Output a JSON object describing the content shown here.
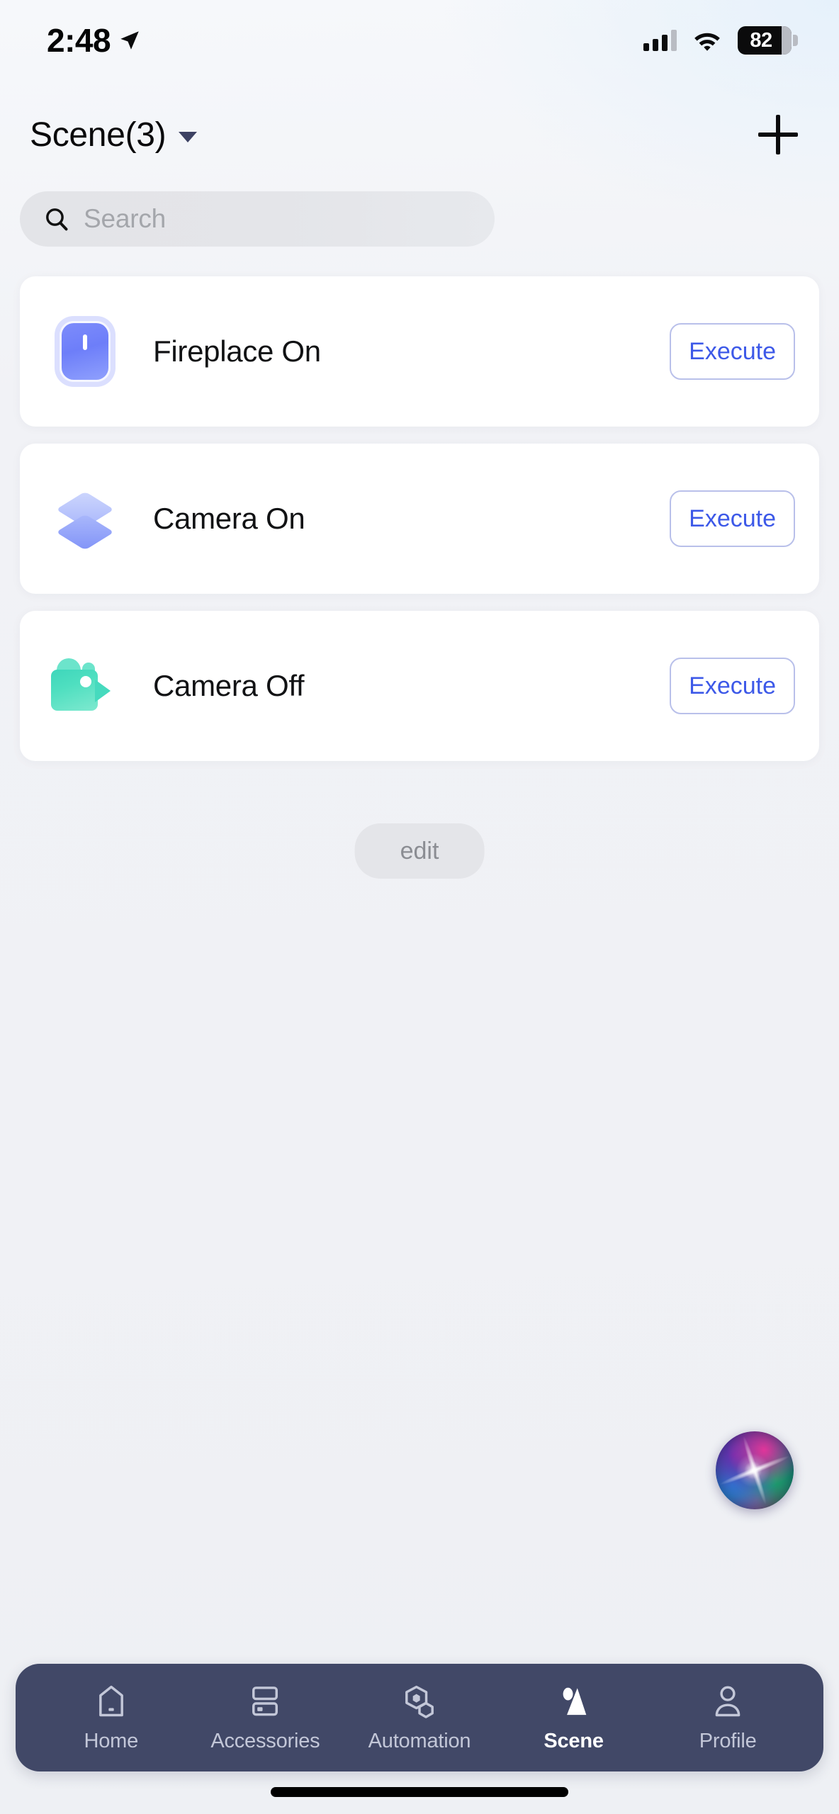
{
  "status_bar": {
    "time": "2:48",
    "location_icon": "location-arrow-icon",
    "signal_icon": "cellular-signal-icon",
    "wifi_icon": "wifi-icon",
    "battery_percent": "82"
  },
  "header": {
    "title": "Scene(3)",
    "dropdown_icon": "chevron-down-icon",
    "add_label": "+",
    "add_icon": "plus-icon"
  },
  "search": {
    "placeholder": "Search",
    "icon": "search-icon",
    "value": ""
  },
  "scenes": [
    {
      "name": "Fireplace On",
      "icon": "switch-icon",
      "icon_color": "#7d8cfb",
      "action_label": "Execute"
    },
    {
      "name": "Camera On",
      "icon": "layers-icon",
      "icon_color": "#8294f8",
      "action_label": "Execute"
    },
    {
      "name": "Camera Off",
      "icon": "video-camera-icon",
      "icon_color": "#46dabe",
      "action_label": "Execute"
    }
  ],
  "edit_button": {
    "label": "edit"
  },
  "assistant": {
    "icon": "siri-orb-icon"
  },
  "tabbar": {
    "items": [
      {
        "label": "Home",
        "icon": "home-icon",
        "active": false
      },
      {
        "label": "Accessories",
        "icon": "devices-icon",
        "active": false
      },
      {
        "label": "Automation",
        "icon": "automation-icon",
        "active": false
      },
      {
        "label": "Scene",
        "icon": "scene-icon",
        "active": true
      },
      {
        "label": "Profile",
        "icon": "person-icon",
        "active": false
      }
    ]
  },
  "colors": {
    "accent": "#3d59e8",
    "tabbar_bg": "#414867",
    "card_bg": "#ffffff",
    "page_bg": "#f0f1f5"
  }
}
